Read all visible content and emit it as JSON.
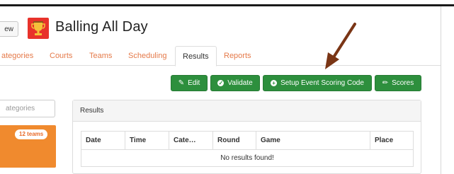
{
  "header": {
    "view_button": "ew",
    "event_title": "Balling All Day"
  },
  "tabs": [
    {
      "label": "ategories"
    },
    {
      "label": "Courts"
    },
    {
      "label": "Teams"
    },
    {
      "label": "Scheduling"
    },
    {
      "label": "Results",
      "active": true
    },
    {
      "label": "Reports"
    }
  ],
  "toolbar": {
    "edit_label": "Edit",
    "validate_label": "Validate",
    "setup_label": "Setup Event Scoring Code",
    "scores_label": "Scores"
  },
  "sidebar": {
    "categories_placeholder": "ategories",
    "teams_badge": "12 teams"
  },
  "results": {
    "heading": "Results",
    "columns": [
      "Date",
      "Time",
      "Cate…",
      "Round",
      "Game",
      "Place"
    ],
    "empty_message": "No results found!"
  },
  "colors": {
    "accent": "#e57a4a",
    "button_green": "#2d8f3d",
    "logo_red": "#e8322b",
    "teams_orange": "#f08a2e",
    "arrow_brown": "#7a3515"
  }
}
